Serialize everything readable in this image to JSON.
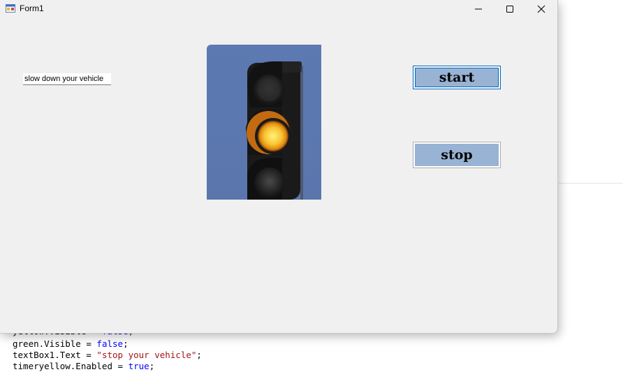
{
  "window": {
    "title": "Form1"
  },
  "form": {
    "textbox_value": "slow down your vehicle",
    "start_label": "start",
    "stop_label": "stop"
  },
  "icons": {
    "app": "windows-form-icon",
    "minimize": "minimize-icon",
    "maximize": "maximize-icon",
    "close": "close-icon",
    "traffic_light": "traffic-light-yellow-image"
  },
  "colors": {
    "button_fill": "#98b3d3",
    "form_background": "#f0f0f0",
    "sky": "#5b78b0",
    "lamp_yellow": "#f7c531"
  },
  "code_behind": {
    "line1_prefix": "yellow.Visible = ",
    "line1_value": "false",
    "line1_suffix": ";",
    "line2_prefix": "green.Visible = ",
    "line2_value": "false",
    "line2_suffix": ";",
    "line3_prefix": "textBox1.Text = ",
    "line3_value": "\"stop your vehicle\"",
    "line3_suffix": ";",
    "line4_prefix": "timeryellow.Enabled = ",
    "line4_value": "true",
    "line4_suffix": ";"
  }
}
